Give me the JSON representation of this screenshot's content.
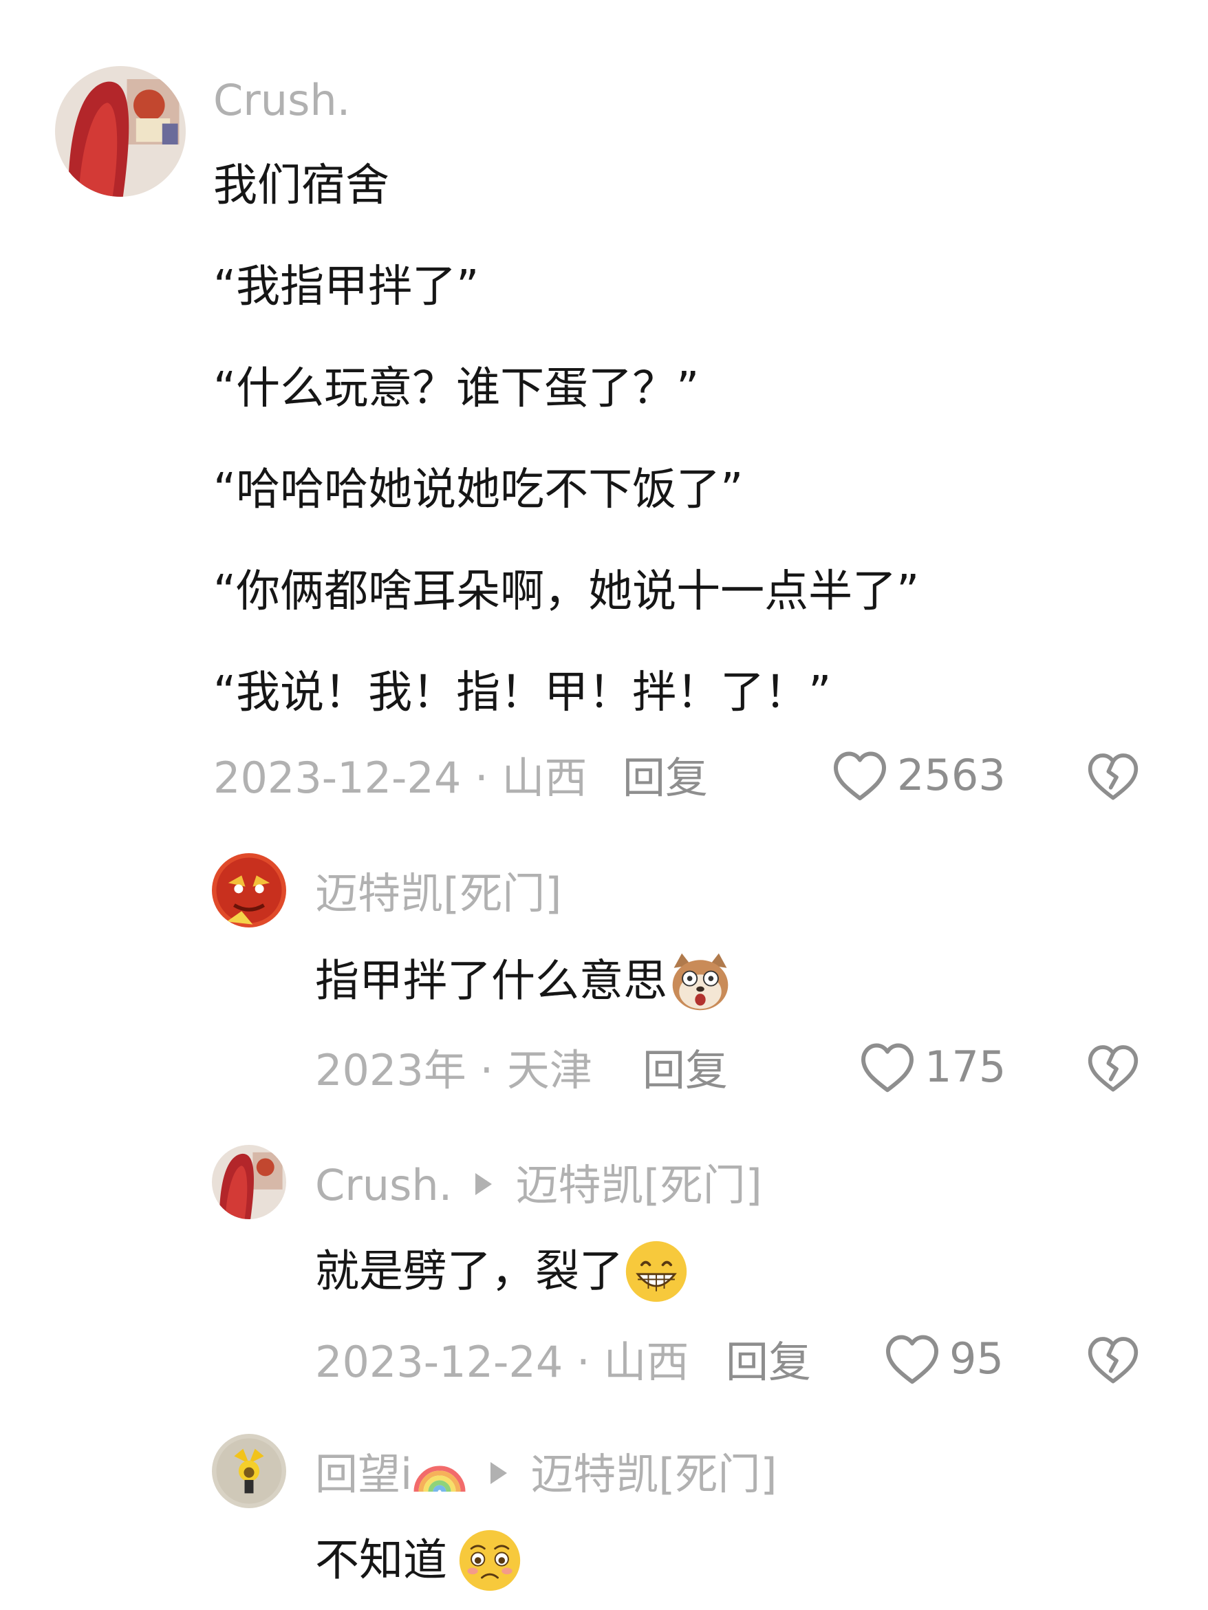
{
  "comments": [
    {
      "username": "Crush.",
      "lines": [
        "我们宿舍",
        "“我指甲拌了”",
        "“什么玩意？谁下蛋了？”",
        "“哈哈哈她说她吃不下饭了”",
        "“你俩都啥耳朵啊，她说十一点半了”",
        "“我说！我！指！甲！拌！了！”"
      ],
      "date_location": "2023-12-24 · 山西",
      "reply_label": "回复",
      "likes": "2563"
    }
  ],
  "replies": [
    {
      "username": "迈特凯[死门]",
      "text": "指甲拌了什么意思",
      "emoji": "dog-face-emoji",
      "date_location": "2023年 · 天津",
      "reply_label": "回复",
      "likes": "175"
    },
    {
      "username": "Crush.",
      "reply_to": "迈特凯[死门]",
      "text": "就是劈了，裂了",
      "emoji": "grin-emoji",
      "date_location": "2023-12-24 · 山西",
      "reply_label": "回复",
      "likes": "95"
    },
    {
      "username": "回望i",
      "username_emoji": "rainbow-emoji",
      "reply_to": "迈特凯[死门]",
      "text": "不知道",
      "emoji": "pleading-emoji"
    }
  ],
  "colors": {
    "username": "#b1b1b1",
    "meta": "#b1b1b1",
    "text": "#161616",
    "icon": "#8e8e8e"
  }
}
